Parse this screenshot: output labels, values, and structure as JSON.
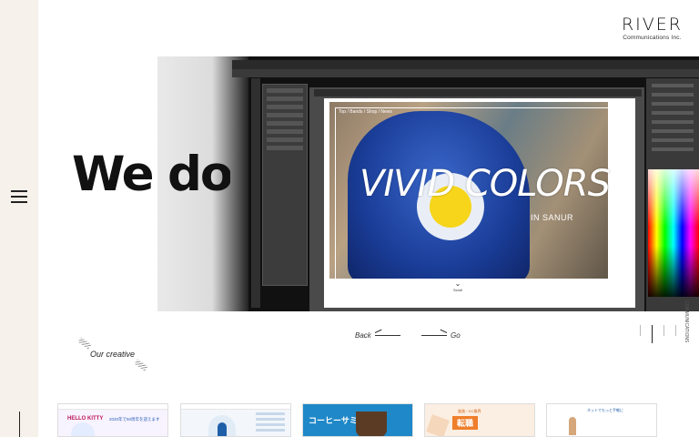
{
  "header": {
    "logo_main": "RIVER",
    "logo_sub": "Communications Inc."
  },
  "hero": {
    "headline": "We do",
    "mockup_title": "VIVID COLORS",
    "mockup_subtitle": "IN SANUR",
    "mockup_nav": "Top  /  Bands  /  Shop  /  News",
    "scroll_label": "Scroll",
    "side_caption": "COMMUNICATIONS"
  },
  "slider": {
    "back_label": "Back",
    "go_label": "Go",
    "slide_count": 4,
    "active_slide": 2
  },
  "section": {
    "our_creative": "Our creative"
  },
  "thumbnails": [
    {
      "logo": "HELLO KITTY",
      "text": "2020年で50周年を迎えます"
    },
    {
      "text": ""
    },
    {
      "text": "コーヒーサミット"
    },
    {
      "top": "進路・EC業界",
      "text": "転職"
    },
    {
      "text": "ネットでもっと手軽に"
    }
  ],
  "colors": {
    "rail_bg": "#f6f1ea",
    "accent_yellow": "#f6d51a",
    "accent_blue": "#1a3d98"
  }
}
